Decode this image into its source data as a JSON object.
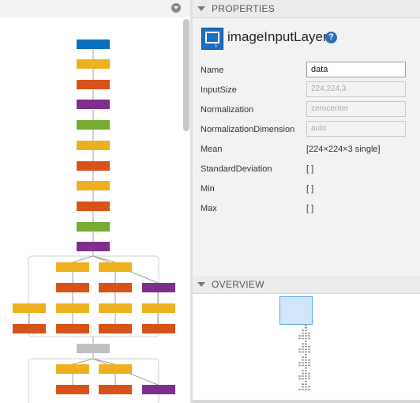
{
  "colors": {
    "input_blue": "#0a6fbe",
    "yellow": "#edb120",
    "orange": "#d95319",
    "purple": "#7e2f8e",
    "green": "#77ac30",
    "gray": "#c0c0c0"
  },
  "graph": {
    "node_colors": [
      "input_blue",
      "yellow",
      "orange",
      "purple",
      "green",
      "yellow",
      "orange",
      "yellow",
      "orange",
      "green",
      "purple"
    ]
  },
  "properties": {
    "section_title": "PROPERTIES",
    "layer_type": "imageInputLayer",
    "help_icon": "?",
    "fields": [
      {
        "label": "Name",
        "value": "data",
        "kind": "input"
      },
      {
        "label": "InputSize",
        "value": "224,224,3",
        "kind": "disabled"
      },
      {
        "label": "Normalization",
        "value": "zerocenter",
        "kind": "disabled"
      },
      {
        "label": "NormalizationDimension",
        "value": "auto",
        "kind": "disabled"
      },
      {
        "label": "Mean",
        "value": "[224×224×3 single]",
        "kind": "text"
      },
      {
        "label": "StandardDeviation",
        "value": "[ ]",
        "kind": "text"
      },
      {
        "label": "Min",
        "value": "[ ]",
        "kind": "text"
      },
      {
        "label": "Max",
        "value": "[ ]",
        "kind": "text"
      }
    ]
  },
  "overview": {
    "section_title": "OVERVIEW"
  }
}
